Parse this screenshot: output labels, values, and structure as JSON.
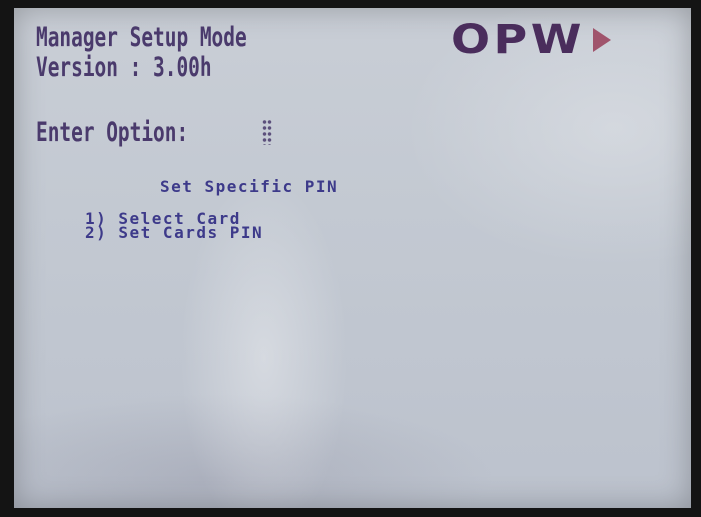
{
  "header": {
    "title": "Manager Setup Mode",
    "version": "Version : 3.00h"
  },
  "brand": {
    "logo_text": "OPW",
    "logo_icon": "arrow-right-icon",
    "logo_color": "#4a2d5c",
    "arrow_color": "#a0546c"
  },
  "prompt": {
    "label": "Enter Option: "
  },
  "submenu": {
    "title": "Set Specific PIN",
    "options": [
      {
        "label": "1) Select Card"
      },
      {
        "label": "2) Set Cards PIN"
      }
    ]
  },
  "colors": {
    "lcd_text": "#4a3a6c",
    "lcd_menu_text": "#3d3a8a",
    "lcd_background": "#c3c9d2",
    "bezel": "#141414"
  }
}
